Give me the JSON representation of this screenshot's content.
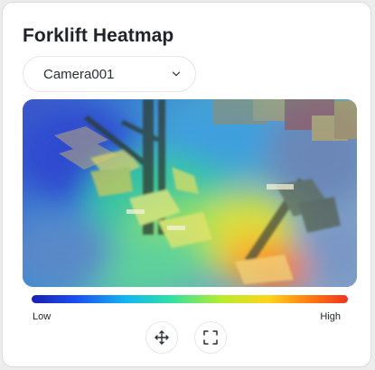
{
  "title": "Forklift Heatmap",
  "camera_select": {
    "selected": "Camera001"
  },
  "legend": {
    "low": "Low",
    "high": "High"
  },
  "icons": {
    "dropdown": "chevron-down-icon",
    "pan": "move-arrows-icon",
    "fullscreen": "fullscreen-icon"
  },
  "colors": {
    "heat_low": "#1b1fb3",
    "heat_mid": "#2fe0a4",
    "heat_high": "#f0331f",
    "title_text": "#1f2329"
  }
}
